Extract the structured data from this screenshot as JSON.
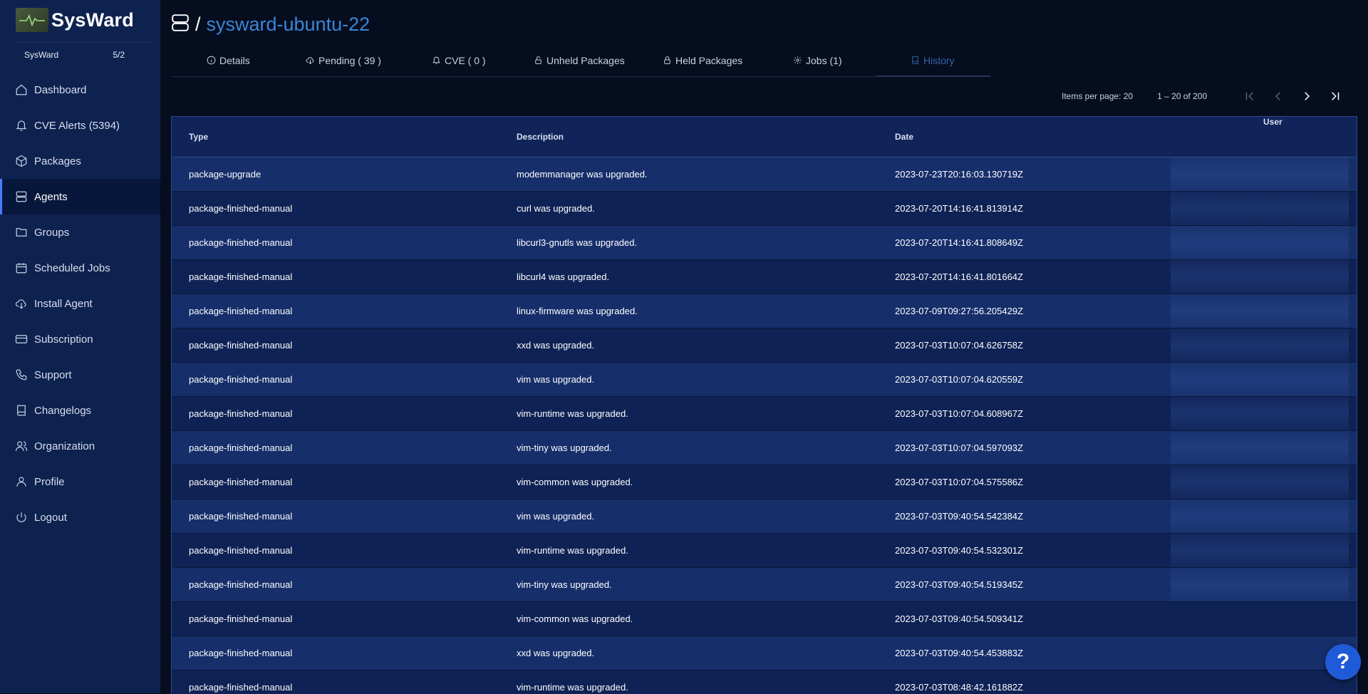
{
  "app": {
    "name": "SysWard",
    "org_name": "SysWard",
    "org_count": "5/2"
  },
  "sidebar": {
    "items": [
      {
        "label": "Dashboard",
        "icon": "home-icon"
      },
      {
        "label": "CVE Alerts (5394)",
        "icon": "bell-icon"
      },
      {
        "label": "Packages",
        "icon": "box-icon"
      },
      {
        "label": "Agents",
        "icon": "server-icon",
        "active": true
      },
      {
        "label": "Groups",
        "icon": "folder-icon"
      },
      {
        "label": "Scheduled Jobs",
        "icon": "calendar-icon"
      },
      {
        "label": "Install Agent",
        "icon": "cloud-download-icon"
      },
      {
        "label": "Subscription",
        "icon": "credit-card-icon"
      },
      {
        "label": "Support",
        "icon": "phone-icon"
      },
      {
        "label": "Changelogs",
        "icon": "book-icon"
      },
      {
        "label": "Organization",
        "icon": "users-icon"
      },
      {
        "label": "Profile",
        "icon": "user-icon"
      },
      {
        "label": "Logout",
        "icon": "power-icon"
      }
    ]
  },
  "header": {
    "separator": "/",
    "title": "sysward-ubuntu-22"
  },
  "tabs": [
    {
      "label": "Details",
      "icon": "info-icon"
    },
    {
      "label": "Pending ( 39 )",
      "icon": "cloud-download-icon"
    },
    {
      "label": "CVE ( 0 )",
      "icon": "bell-icon"
    },
    {
      "label": "Unheld Packages",
      "icon": "unlock-icon"
    },
    {
      "label": "Held Packages",
      "icon": "lock-icon"
    },
    {
      "label": "Jobs (1)",
      "icon": "gear-icon"
    },
    {
      "label": "History",
      "icon": "book-icon",
      "active": true
    }
  ],
  "paginator": {
    "items_per_page_label": "Items per page: 20",
    "range": "1 – 20 of 200"
  },
  "table": {
    "columns": [
      "Type",
      "Description",
      "Date",
      "User"
    ],
    "rows": [
      {
        "type": "package-upgrade",
        "description": "modemmanager was upgraded.",
        "date": "2023-07-23T20:16:03.130719Z"
      },
      {
        "type": "package-finished-manual",
        "description": "curl was upgraded.",
        "date": "2023-07-20T14:16:41.813914Z"
      },
      {
        "type": "package-finished-manual",
        "description": "libcurl3-gnutls was upgraded.",
        "date": "2023-07-20T14:16:41.808649Z"
      },
      {
        "type": "package-finished-manual",
        "description": "libcurl4 was upgraded.",
        "date": "2023-07-20T14:16:41.801664Z"
      },
      {
        "type": "package-finished-manual",
        "description": "linux-firmware was upgraded.",
        "date": "2023-07-09T09:27:56.205429Z"
      },
      {
        "type": "package-finished-manual",
        "description": "xxd was upgraded.",
        "date": "2023-07-03T10:07:04.626758Z"
      },
      {
        "type": "package-finished-manual",
        "description": "vim was upgraded.",
        "date": "2023-07-03T10:07:04.620559Z"
      },
      {
        "type": "package-finished-manual",
        "description": "vim-runtime was upgraded.",
        "date": "2023-07-03T10:07:04.608967Z"
      },
      {
        "type": "package-finished-manual",
        "description": "vim-tiny was upgraded.",
        "date": "2023-07-03T10:07:04.597093Z"
      },
      {
        "type": "package-finished-manual",
        "description": "vim-common was upgraded.",
        "date": "2023-07-03T10:07:04.575586Z"
      },
      {
        "type": "package-finished-manual",
        "description": "vim was upgraded.",
        "date": "2023-07-03T09:40:54.542384Z"
      },
      {
        "type": "package-finished-manual",
        "description": "vim-runtime was upgraded.",
        "date": "2023-07-03T09:40:54.532301Z"
      },
      {
        "type": "package-finished-manual",
        "description": "vim-tiny was upgraded.",
        "date": "2023-07-03T09:40:54.519345Z"
      },
      {
        "type": "package-finished-manual",
        "description": "vim-common was upgraded.",
        "date": "2023-07-03T09:40:54.509341Z"
      },
      {
        "type": "package-finished-manual",
        "description": "xxd was upgraded.",
        "date": "2023-07-03T09:40:54.453883Z"
      },
      {
        "type": "package-finished-manual",
        "description": "vim-runtime was upgraded.",
        "date": "2023-07-03T08:48:42.161882Z"
      }
    ]
  },
  "help": {
    "label": "?"
  }
}
